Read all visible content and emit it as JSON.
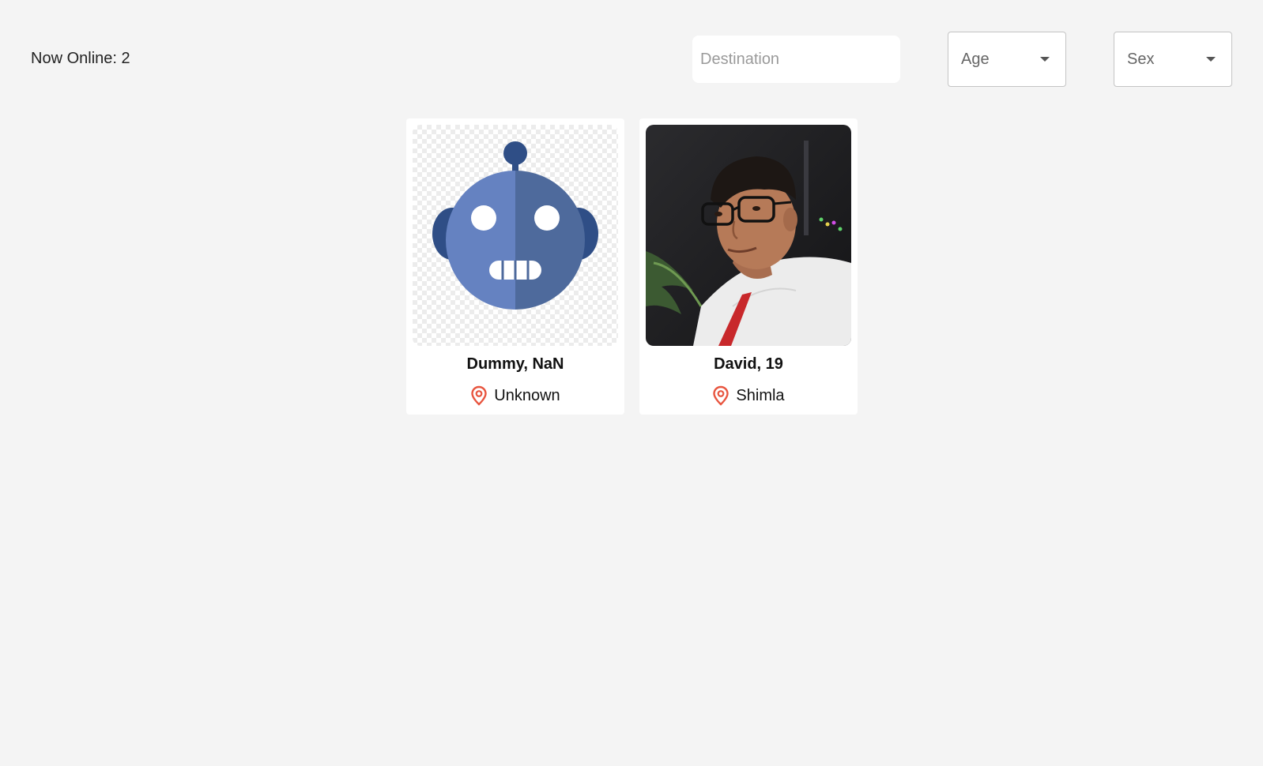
{
  "header": {
    "online_text": "Now Online: 2"
  },
  "filters": {
    "destination_placeholder": "Destination",
    "destination_value": "",
    "age_label": "Age",
    "sex_label": "Sex"
  },
  "profiles": [
    {
      "name_age": "Dummy, NaN",
      "location": "Unknown",
      "avatar": "robot-avatar"
    },
    {
      "name_age": "David, 19",
      "location": "Shimla",
      "avatar": "user-photo"
    }
  ],
  "colors": {
    "background": "#f4f4f4",
    "pin": "#e8553f",
    "robot_light": "#6582c1",
    "robot_dark": "#4e6a9c",
    "robot_ears": "#2f4e86"
  }
}
